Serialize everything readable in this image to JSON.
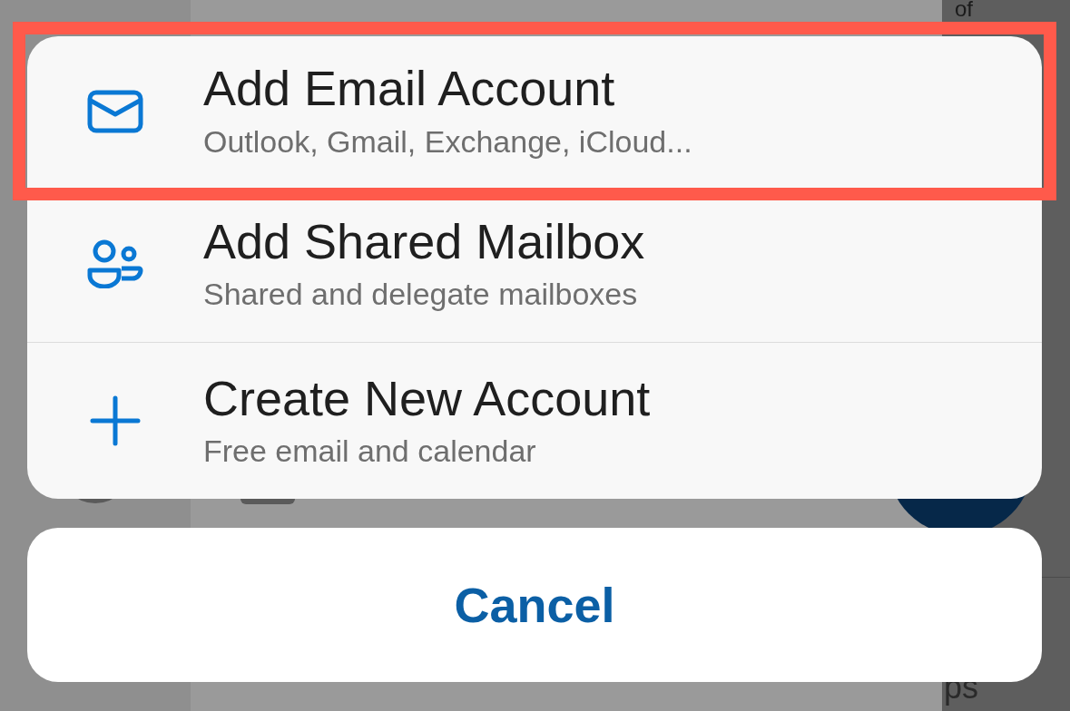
{
  "background": {
    "top_text": "of",
    "bottom_text": "ps"
  },
  "sheet": {
    "items": [
      {
        "kind": "mail",
        "title": "Add Email Account",
        "subtitle": "Outlook, Gmail, Exchange, iCloud...",
        "highlighted": true
      },
      {
        "kind": "people",
        "title": "Add Shared Mailbox",
        "subtitle": "Shared and delegate mailboxes",
        "highlighted": false
      },
      {
        "kind": "plus",
        "title": "Create New Account",
        "subtitle": "Free email and calendar",
        "highlighted": false
      }
    ]
  },
  "cancel": {
    "label": "Cancel"
  }
}
